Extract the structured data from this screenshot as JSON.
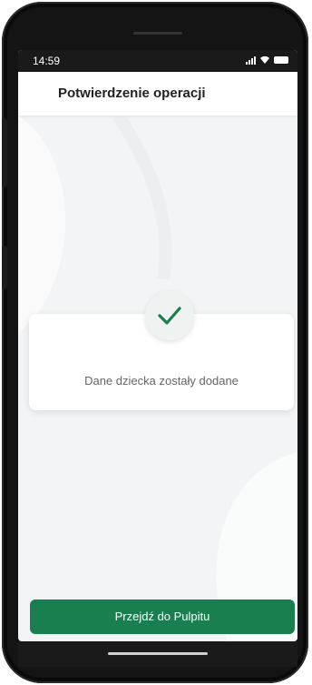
{
  "status_bar": {
    "time": "14:59",
    "icons": [
      "signal-icon",
      "wifi-icon",
      "battery-icon"
    ]
  },
  "header": {
    "title": "Potwierdzenie operacji"
  },
  "confirmation": {
    "icon": "check-icon",
    "message": "Dane dziecka zostały dodane"
  },
  "actions": {
    "primary_label": "Przejdź do Pulpitu"
  },
  "colors": {
    "accent": "#1a7f4e",
    "check": "#1a7f4e",
    "background": "#f3f4f5"
  }
}
